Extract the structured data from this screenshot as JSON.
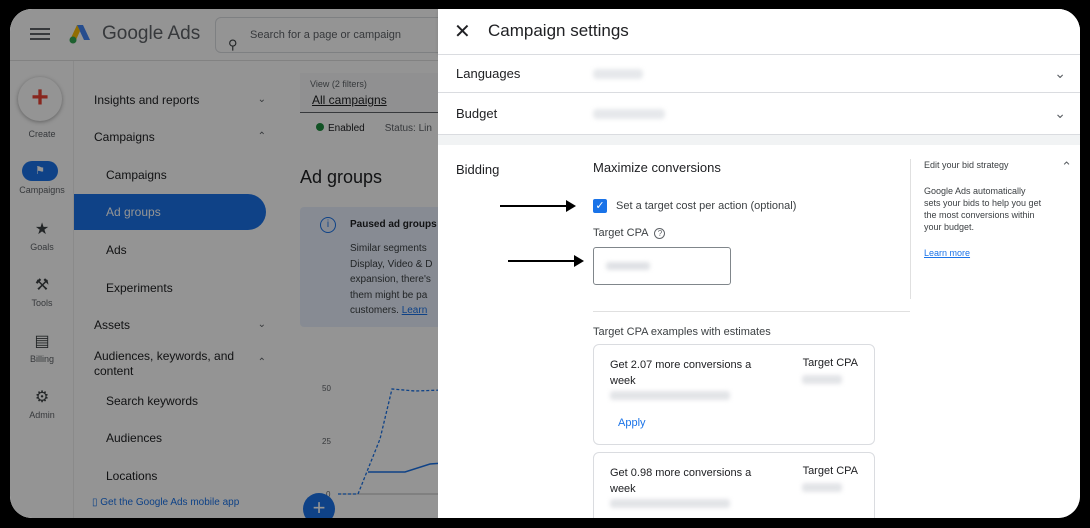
{
  "app": {
    "brand": "Google Ads",
    "search_placeholder": "Search for a page or campaign"
  },
  "rail": [
    {
      "label": "Create"
    },
    {
      "label": "Campaigns"
    },
    {
      "label": "Goals"
    },
    {
      "label": "Tools"
    },
    {
      "label": "Billing"
    },
    {
      "label": "Admin"
    }
  ],
  "nav": {
    "items": [
      {
        "label": "Insights and reports"
      },
      {
        "label": "Campaigns"
      },
      {
        "label": "Campaigns"
      },
      {
        "label": "Ad groups"
      },
      {
        "label": "Ads"
      },
      {
        "label": "Experiments"
      },
      {
        "label": "Assets"
      },
      {
        "label": "Audiences, keywords, and content"
      },
      {
        "label": "Search keywords"
      },
      {
        "label": "Audiences"
      },
      {
        "label": "Locations"
      }
    ],
    "mobile_link": "Get the Google Ads mobile app"
  },
  "content": {
    "view_label": "View (2 filters)",
    "view_value": "All campaigns",
    "filter_enabled": "Enabled",
    "filter_status": "Status: Lin",
    "heading": "Ad groups",
    "info_title": "Paused ad groups",
    "info_text": "Similar segments\nDisplay, Video & D\nexpansion, there's\nthem might be pa\ncustomers.",
    "info_link": "Learn",
    "chart_ticks": [
      "50",
      "25",
      "0"
    ]
  },
  "panel": {
    "title": "Campaign settings",
    "languages_label": "Languages",
    "budget_label": "Budget",
    "bidding_label": "Bidding",
    "strategy": "Maximize conversions",
    "checkbox_label": "Set a target cost per action (optional)",
    "target_cpa_label": "Target CPA",
    "examples_label": "Target CPA examples with estimates",
    "cards": [
      {
        "title": "Get 2.07 more conversions a week",
        "cpa_label": "Target CPA",
        "action": "Apply"
      },
      {
        "title": "Get 0.98 more conversions a week",
        "cpa_label": "Target CPA"
      }
    ],
    "side": {
      "title": "Edit your bid strategy",
      "text": "Google Ads automatically sets your bids to help you get the most conversions within your budget.",
      "link": "Learn more"
    }
  },
  "colors": {
    "accent": "#1a73e8",
    "enabled": "#1e8e3e"
  }
}
